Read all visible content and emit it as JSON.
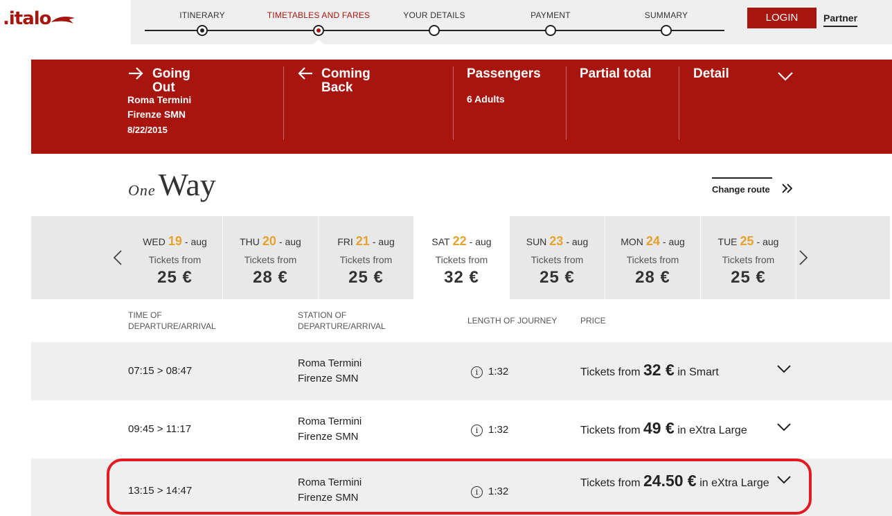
{
  "brand": {
    "logo_text": ".italo",
    "accent": "#a8150e",
    "highlight": "#e6a22c"
  },
  "steps": [
    {
      "label": "ITINERARY",
      "state": "done"
    },
    {
      "label": "TIMETABLES AND FARES",
      "state": "active"
    },
    {
      "label": "YOUR DETAILS",
      "state": "todo"
    },
    {
      "label": "PAYMENT",
      "state": "todo"
    },
    {
      "label": "SUMMARY",
      "state": "todo"
    }
  ],
  "header": {
    "login_label": "LOGIN",
    "partner_label": "Partner"
  },
  "summary": {
    "going": {
      "title_line1": "Going",
      "title_line2": "Out",
      "from": "Roma Termini",
      "to": "Firenze SMN",
      "date": "8/22/2015",
      "icon": "arrow-right-icon"
    },
    "coming": {
      "title_line1": "Coming",
      "title_line2": "Back",
      "icon": "arrow-left-icon"
    },
    "passengers": {
      "title": "Passengers",
      "value": "6 Adults"
    },
    "partial_total": {
      "title": "Partial total"
    },
    "detail": {
      "title": "Detail",
      "icon": "chevron-down-icon"
    }
  },
  "trip": {
    "label_small": "One",
    "label_big": "Way",
    "change_route": "Change route"
  },
  "dates": [
    {
      "dow": "WED",
      "day": "19",
      "month": "- aug",
      "from": "Tickets from",
      "price": "25 €",
      "selected": false
    },
    {
      "dow": "THU",
      "day": "20",
      "month": "- aug",
      "from": "Tickets from",
      "price": "28 €",
      "selected": false
    },
    {
      "dow": "FRI",
      "day": "21",
      "month": "- aug",
      "from": "Tickets from",
      "price": "25 €",
      "selected": false
    },
    {
      "dow": "SAT",
      "day": "22",
      "month": "- aug",
      "from": "Tickets from",
      "price": "32 €",
      "selected": true
    },
    {
      "dow": "SUN",
      "day": "23",
      "month": "- aug",
      "from": "Tickets from",
      "price": "25 €",
      "selected": false
    },
    {
      "dow": "MON",
      "day": "24",
      "month": "- aug",
      "from": "Tickets from",
      "price": "28 €",
      "selected": false
    },
    {
      "dow": "TUE",
      "day": "25",
      "month": "- aug",
      "from": "Tickets from",
      "price": "25 €",
      "selected": false
    }
  ],
  "columns": {
    "time_l1": "TIME OF",
    "time_l2": "DEPARTURE/ARRIVAL",
    "station_l1": "STATION OF",
    "station_l2": "DEPARTURE/ARRIVAL",
    "length": "LENGTH OF JOURNEY",
    "price": "PRICE"
  },
  "results": [
    {
      "time": "07:15 > 08:47",
      "from": "Roma Termini",
      "to": "Firenze SMN",
      "duration": "1:32",
      "price_prefix": "Tickets from",
      "price": "32 €",
      "price_suffix": "in Smart",
      "highlighted": false
    },
    {
      "time": "09:45 > 11:17",
      "from": "Roma Termini",
      "to": "Firenze SMN",
      "duration": "1:32",
      "price_prefix": "Tickets from",
      "price": "49 €",
      "price_suffix": "in eXtra Large",
      "highlighted": false
    },
    {
      "time": "13:15 > 14:47",
      "from": "Roma Termini",
      "to": "Firenze SMN",
      "duration": "1:32",
      "price_prefix": "Tickets from",
      "price": "24.50 €",
      "price_suffix": "in eXtra Large",
      "highlighted": true
    }
  ]
}
